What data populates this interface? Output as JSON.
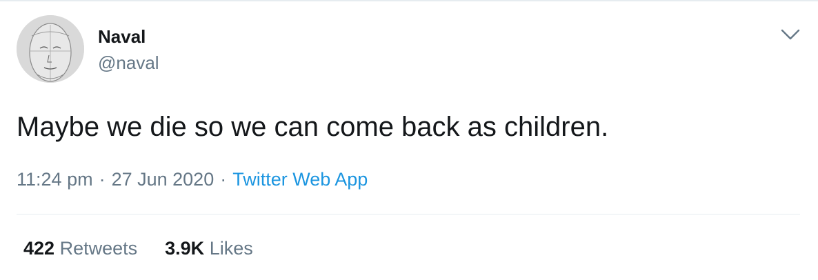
{
  "author": {
    "name": "Naval",
    "handle": "@naval"
  },
  "tweet": {
    "text": "Maybe we die so we can come back as children.",
    "time": "11:24 pm",
    "date": "27 Jun 2020",
    "source": "Twitter Web App",
    "separator": "·"
  },
  "stats": {
    "retweets_count": "422",
    "retweets_label": "Retweets",
    "likes_count": "3.9K",
    "likes_label": "Likes"
  },
  "icons": {
    "menu": "chevron-down-icon"
  },
  "colors": {
    "text": "#14171a",
    "secondary": "#657786",
    "link": "#1b95e0",
    "border": "#e6ecf0"
  }
}
